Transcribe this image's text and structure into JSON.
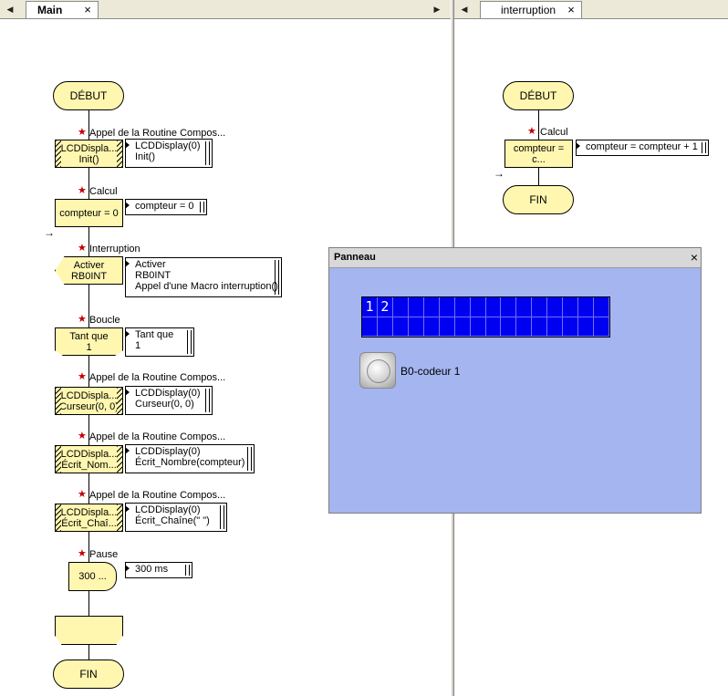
{
  "tabs": {
    "main": {
      "label": "Main",
      "close": "×"
    },
    "interruption": {
      "label": "interruption",
      "close": "×"
    },
    "nav_left": "◀",
    "nav_right": "▶"
  },
  "main_flow": {
    "debut": "DÉBUT",
    "step1": {
      "label": "Appel de la Routine Compos...",
      "box": [
        "LCDDispla...",
        "Init()"
      ],
      "note": [
        "LCDDisplay(0)",
        "Init()"
      ]
    },
    "step2": {
      "label": "Calcul",
      "box": [
        "compteur = 0"
      ],
      "note": [
        "compteur = 0"
      ]
    },
    "step3": {
      "label": "Interruption",
      "box": [
        "Activer",
        "RB0INT"
      ],
      "note": [
        "Activer",
        "RB0INT",
        "Appel d'une Macro interruption()"
      ]
    },
    "step4": {
      "label": "Boucle",
      "box": [
        "Tant que",
        "1"
      ],
      "note": [
        "Tant que",
        "1"
      ]
    },
    "step5": {
      "label": "Appel de la Routine Compos...",
      "box": [
        "LCDDispla...",
        "Curseur(0, 0)"
      ],
      "note": [
        "LCDDisplay(0)",
        "Curseur(0, 0)"
      ]
    },
    "step6": {
      "label": "Appel de la Routine Compos...",
      "box": [
        "LCDDispla...",
        "Écrit_Nom..."
      ],
      "note": [
        "LCDDisplay(0)",
        "Écrit_Nombre(compteur)"
      ]
    },
    "step7": {
      "label": "Appel de la Routine Compos...",
      "box": [
        "LCDDispla...",
        "Écrit_Chaî..."
      ],
      "note": [
        "LCDDisplay(0)",
        "Écrit_Chaîne(\"  \")"
      ]
    },
    "step8": {
      "label": "Pause",
      "box": [
        "300 ..."
      ],
      "note": [
        "300 ms"
      ]
    },
    "fin": "FIN"
  },
  "int_flow": {
    "debut": "DÉBUT",
    "step1": {
      "label": "Calcul",
      "box": [
        "compteur = c..."
      ],
      "note": [
        "compteur = compteur + 1"
      ]
    },
    "fin": "FIN"
  },
  "markers": {
    "star": "★",
    "arrow": "→"
  },
  "panel": {
    "title": "Panneau",
    "close": "×",
    "lcd": {
      "row1": [
        "1",
        "2",
        "",
        "",
        "",
        "",
        "",
        "",
        "",
        "",
        "",
        "",
        "",
        "",
        "",
        ""
      ],
      "row2": [
        "",
        "",
        "",
        "",
        "",
        "",
        "",
        "",
        "",
        "",
        "",
        "",
        "",
        "",
        "",
        ""
      ]
    },
    "switch_label": "B0-codeur 1"
  },
  "colors": {
    "node_fill": "#fff7b0",
    "panel_bg": "#a5b5f0",
    "lcd_bg": "#0000f0",
    "star": "#c00000"
  }
}
